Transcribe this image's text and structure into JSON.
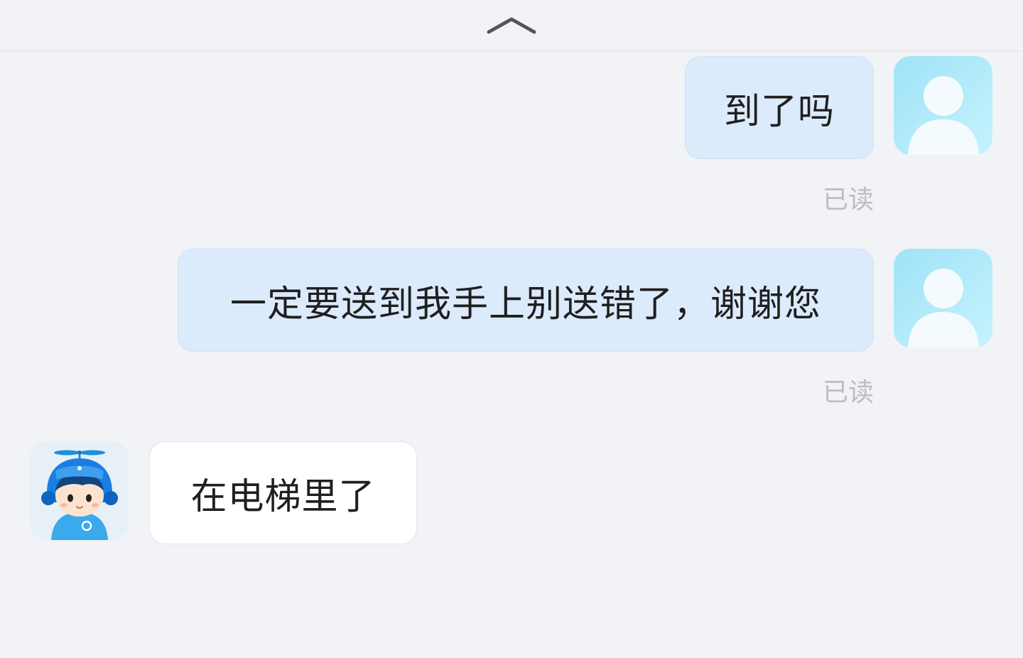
{
  "header": {
    "collapse_icon": "chevron-up-icon"
  },
  "messages": [
    {
      "direction": "outgoing",
      "text": "到了吗",
      "status": "已读",
      "avatar_icon": "default-user-avatar"
    },
    {
      "direction": "outgoing",
      "text": "一定要送到我手上别送错了，谢谢您",
      "status": "已读",
      "avatar_icon": "default-user-avatar"
    },
    {
      "direction": "incoming",
      "text": "在电梯里了",
      "avatar_icon": "courier-mascot-avatar"
    }
  ],
  "colors": {
    "background": "#f1f3f7",
    "outgoing_bubble": "#dcebfc",
    "incoming_bubble": "#ffffff",
    "read_status": "#bdbdbd"
  }
}
